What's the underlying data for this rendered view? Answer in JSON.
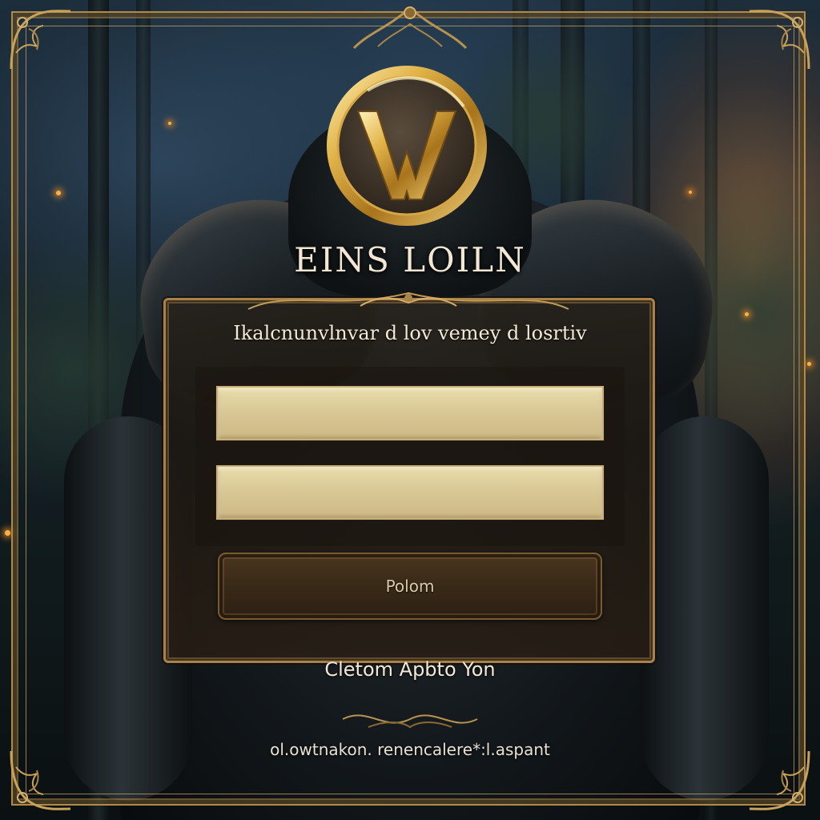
{
  "app": {
    "title": "EINS LOILN",
    "logo_icon": "w-crest-icon"
  },
  "login_panel": {
    "subtitle": "Ikalcnunvlnvar  d lov  vemey d losrtiv",
    "username": {
      "value": "",
      "placeholder": ""
    },
    "password": {
      "value": "",
      "placeholder": ""
    },
    "login_button_label": "Polom",
    "create_account_label": "Cletom Apbto Yon"
  },
  "footer": {
    "link_text": "ol.owtnakon. renencalere*:l.aspant"
  },
  "colors": {
    "accent_gold": "#b08a4a",
    "field_fill": "#e0d19f",
    "text_light": "#f1e7d4"
  }
}
